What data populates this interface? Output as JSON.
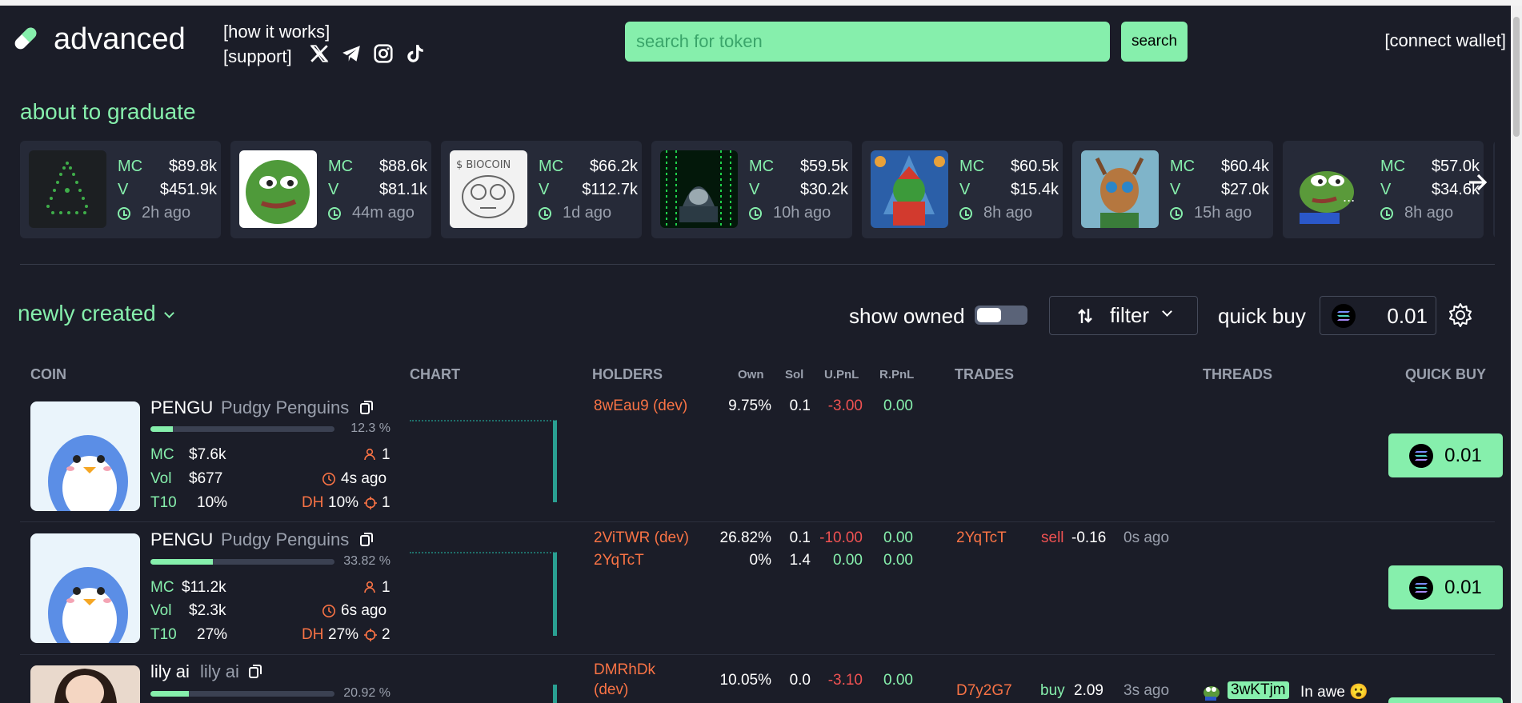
{
  "header": {
    "brand": "advanced",
    "how_it_works": "[how it works]",
    "support": "[support]",
    "search_placeholder": "search for token",
    "search_button": "search",
    "connect_wallet": "[connect wallet]",
    "social_icons": [
      "x-icon",
      "telegram-icon",
      "instagram-icon",
      "tiktok-icon"
    ]
  },
  "graduate": {
    "title": "about to graduate",
    "mc_label": "MC",
    "v_label": "V",
    "cards": [
      {
        "mc": "$89.8k",
        "v": "$451.9k",
        "ago": "2h ago",
        "image": "green-triangle-art"
      },
      {
        "mc": "$88.6k",
        "v": "$81.1k",
        "ago": "44m ago",
        "image": "pepe-frog"
      },
      {
        "mc": "$66.2k",
        "v": "$112.7k",
        "ago": "1d ago",
        "image": "biocoin-sketch"
      },
      {
        "mc": "$59.5k",
        "v": "$30.2k",
        "ago": "10h ago",
        "image": "matrix-hacker"
      },
      {
        "mc": "$60.5k",
        "v": "$15.4k",
        "ago": "8h ago",
        "image": "solana-christmas-frog"
      },
      {
        "mc": "$60.4k",
        "v": "$27.0k",
        "ago": "15h ago",
        "image": "reindeer"
      },
      {
        "mc": "$57.0k",
        "v": "$34.6k",
        "ago": "8h ago",
        "image": "pepe-thinking"
      }
    ]
  },
  "controls": {
    "newly_created": "newly created",
    "show_owned": "show owned",
    "filter": "filter",
    "quick_buy": "quick buy",
    "quick_buy_value": "0.01"
  },
  "table": {
    "headers": {
      "coin": "COIN",
      "chart": "CHART",
      "holders": "HOLDERS",
      "own": "Own",
      "sol": "Sol",
      "upnl": "U.PnL",
      "rpnl": "R.PnL",
      "trades": "TRADES",
      "threads": "THREADS",
      "quick_buy": "QUICK BUY"
    },
    "labels": {
      "mc": "MC",
      "vol": "Vol",
      "t10": "T10",
      "dh": "DH"
    },
    "rows": [
      {
        "ticker": "PENGU",
        "name": "Pudgy Penguins",
        "progress_pct": "12.3 %",
        "progress": 0.123,
        "mc": "$7.6k",
        "vol": "$677",
        "t10": "10%",
        "holders_count": "1",
        "age": "4s ago",
        "dh": "10%",
        "snipers": "1",
        "holders": [
          {
            "addr": "8wEau9 (dev)",
            "own": "9.75%",
            "sol": "0.1",
            "upnl": "-3.00",
            "rpnl": "0.00"
          }
        ],
        "trades": [],
        "thread": null,
        "buy": "0.01"
      },
      {
        "ticker": "PENGU",
        "name": "Pudgy Penguins",
        "progress_pct": "33.82 %",
        "progress": 0.3382,
        "mc": "$11.2k",
        "vol": "$2.3k",
        "t10": "27%",
        "holders_count": "1",
        "age": "6s ago",
        "dh": "27%",
        "snipers": "2",
        "holders": [
          {
            "addr": "2ViTWR (dev)",
            "own": "26.82%",
            "sol": "0.1",
            "upnl": "-10.00",
            "rpnl": "0.00"
          },
          {
            "addr": "2YqTcT",
            "own": "0%",
            "sol": "1.4",
            "upnl": "0.00",
            "rpnl": "0.00"
          }
        ],
        "trades": [
          {
            "addr": "2YqTcT",
            "side": "sell",
            "amount": "-0.16",
            "ago": "0s ago"
          }
        ],
        "thread": null,
        "buy": "0.01"
      },
      {
        "ticker": "lily ai",
        "name": "lily ai",
        "progress_pct": "20.92 %",
        "progress": 0.2092,
        "holders": [
          {
            "addr_line1": "DMRhDk",
            "addr_line2": "(dev)",
            "own": "10.05%",
            "sol": "0.0",
            "upnl": "-3.10",
            "rpnl": "0.00"
          }
        ],
        "trades": [
          {
            "addr": "D7y2G7",
            "side": "buy",
            "amount": "2.09",
            "ago": "3s ago"
          }
        ],
        "thread": {
          "user": "3wKTjm",
          "text": "In awe 😮"
        }
      }
    ]
  }
}
